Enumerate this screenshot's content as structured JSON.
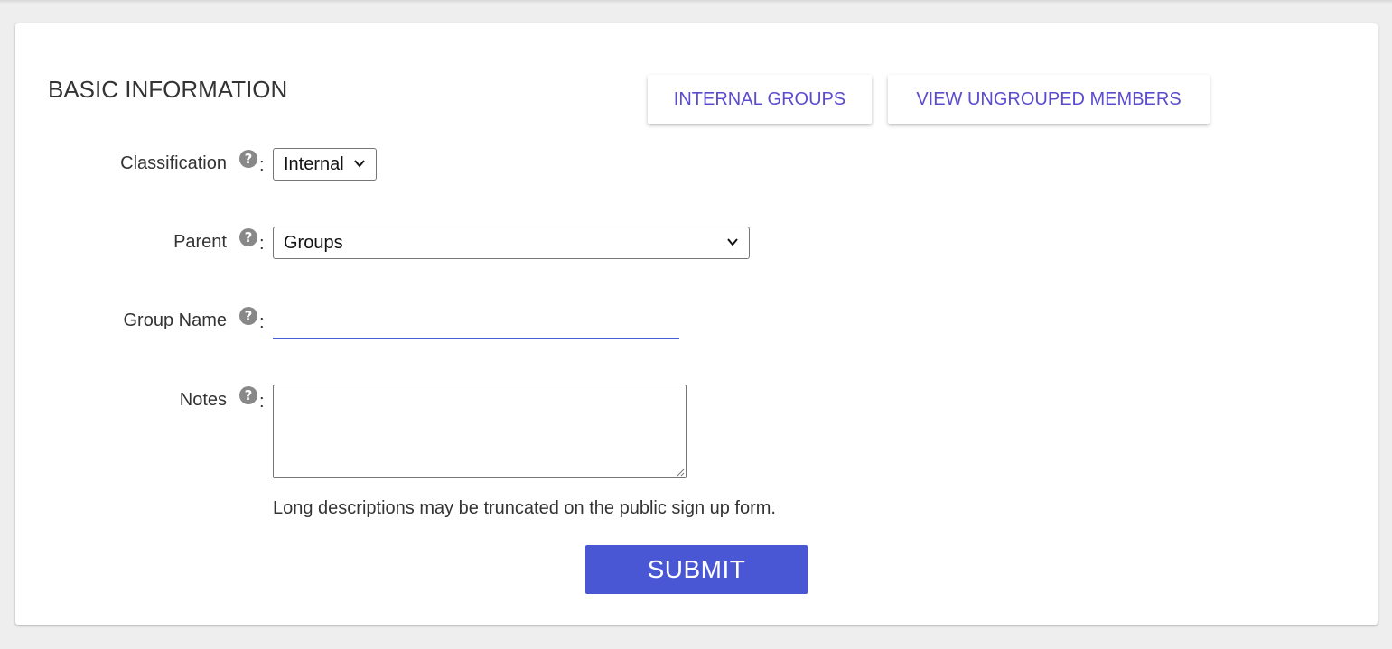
{
  "section": {
    "title": "BASIC INFORMATION"
  },
  "actions": {
    "internal_groups_label": "INTERNAL GROUPS",
    "view_ungrouped_label": "VIEW UNGROUPED MEMBERS"
  },
  "form": {
    "help_glyph": "?",
    "colon": ":",
    "classification": {
      "label": "Classification",
      "selected": "Internal"
    },
    "parent": {
      "label": "Parent",
      "selected": "Groups"
    },
    "group_name": {
      "label": "Group Name",
      "value": ""
    },
    "notes": {
      "label": "Notes",
      "value": "",
      "hint": "Long descriptions may be truncated on the public sign up form."
    },
    "submit_label": "SUBMIT"
  },
  "colors": {
    "page_background": "#eeeeee",
    "link_purple": "#5a4bcf",
    "accent_blue": "#4a57d4",
    "help_icon_gray": "#888888"
  },
  "icons": {
    "help": "question-circle-icon",
    "dropdown": "chevron-down-icon"
  }
}
